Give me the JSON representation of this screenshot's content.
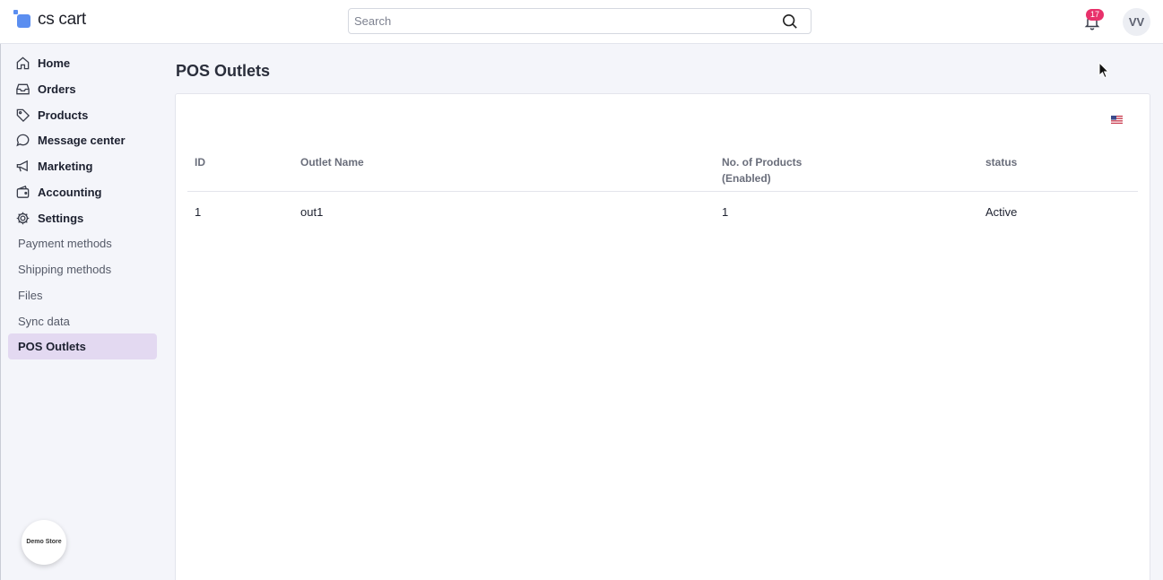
{
  "header": {
    "logo_text": "cs cart",
    "search_placeholder": "Search",
    "notification_count": "17",
    "user_initials": "VV"
  },
  "sidebar": {
    "main_items": [
      {
        "label": "Home",
        "icon": "home-icon"
      },
      {
        "label": "Orders",
        "icon": "inbox-icon"
      },
      {
        "label": "Products",
        "icon": "tag-icon"
      },
      {
        "label": "Message center",
        "icon": "chat-bubble-icon"
      },
      {
        "label": "Marketing",
        "icon": "megaphone-icon"
      },
      {
        "label": "Accounting",
        "icon": "wallet-icon"
      },
      {
        "label": "Settings",
        "icon": "gear-icon"
      }
    ],
    "sub_items": [
      {
        "label": "Payment methods"
      },
      {
        "label": "Shipping methods"
      },
      {
        "label": "Files"
      },
      {
        "label": "Sync data"
      },
      {
        "label": "POS Outlets",
        "active": true
      }
    ],
    "store_button": "Demo Store"
  },
  "main": {
    "page_title": "POS Outlets",
    "language_flag": "us-flag-icon",
    "table": {
      "columns": [
        "ID",
        "Outlet Name",
        "No. of Products\n(Enabled)",
        "status"
      ],
      "rows": [
        {
          "id": "1",
          "name": "out1",
          "products": "1",
          "status": "Active"
        }
      ]
    }
  },
  "colors": {
    "accent": "#5b8ef0",
    "active_nav_bg": "#e3d9f1",
    "badge": "#e8316b"
  }
}
